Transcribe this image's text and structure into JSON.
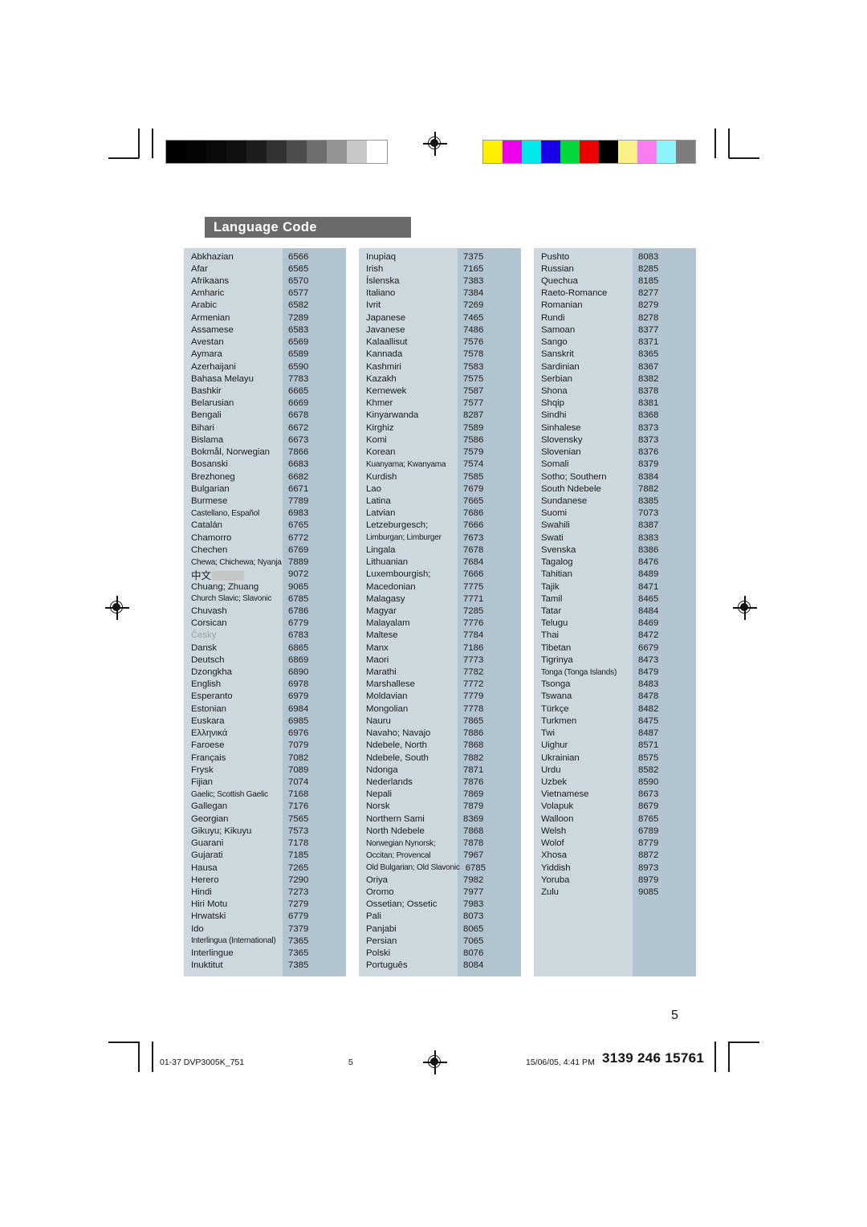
{
  "page": {
    "section_title": "Language Code",
    "page_number": "5"
  },
  "footer": {
    "job_id": "01-37 DVP3005K_751",
    "page_marker": "5",
    "timestamp": "15/06/05, 4:41 PM",
    "doc_code": "3139 246 15761"
  },
  "calibration": {
    "grayscale": [
      "#000000",
      "#040404",
      "#0a0a0a",
      "#111111",
      "#1d1d1d",
      "#333333",
      "#4d4d4d",
      "#6e6e6e",
      "#949494",
      "#c8c8c8",
      "#ffffff"
    ],
    "colors": [
      "#fff000",
      "#ec00ec",
      "#00e8ec",
      "#1800e8",
      "#00d83c",
      "#ec0000",
      "#000000",
      "#fbf287",
      "#fb7cf0",
      "#8cf4fb",
      "#7d7d7d"
    ]
  },
  "columns": [
    {
      "rows": [
        {
          "name": "Abkhazian",
          "code": "6566"
        },
        {
          "name": "Afar",
          "code": "6565"
        },
        {
          "name": "Afrikaans",
          "code": "6570"
        },
        {
          "name": "Amharic",
          "code": "6577"
        },
        {
          "name": "Arabic",
          "code": "6582"
        },
        {
          "name": "Armenian",
          "code": "7289"
        },
        {
          "name": "Assamese",
          "code": "6583"
        },
        {
          "name": "Avestan",
          "code": "6569"
        },
        {
          "name": "Aymara",
          "code": "6589"
        },
        {
          "name": "Azerhaijani",
          "code": "6590"
        },
        {
          "name": "Bahasa Melayu",
          "code": "7783"
        },
        {
          "name": "Bashkir",
          "code": "6665"
        },
        {
          "name": "Belarusian",
          "code": "6669"
        },
        {
          "name": "Bengali",
          "code": "6678"
        },
        {
          "name": "Bihari",
          "code": "6672"
        },
        {
          "name": "Bislama",
          "code": "6673"
        },
        {
          "name": "Bokmål, Norwegian",
          "code": "7866"
        },
        {
          "name": "Bosanski",
          "code": "6683"
        },
        {
          "name": "Brezhoneg",
          "code": "6682"
        },
        {
          "name": "Bulgarian",
          "code": "6671"
        },
        {
          "name": "Burmese",
          "code": "7789"
        },
        {
          "name": "Castellano, Español",
          "code": "6983",
          "narrow": true
        },
        {
          "name": "Catalán",
          "code": "6765"
        },
        {
          "name": "Chamorro",
          "code": "6772"
        },
        {
          "name": "Chechen",
          "code": "6769"
        },
        {
          "name": "Chewa; Chichewa; Nyanja",
          "code": "7889",
          "narrow": true
        },
        {
          "name": "中文",
          "code": "9072",
          "cjk": true,
          "highlight": true
        },
        {
          "name": "Chuang; Zhuang",
          "code": "9065"
        },
        {
          "name": "Church Slavic; Slavonic",
          "code": "6785",
          "narrow": true
        },
        {
          "name": "Chuvash",
          "code": "6786"
        },
        {
          "name": "Corsican",
          "code": "6779"
        },
        {
          "name": "Česky",
          "code": "6783",
          "faded": true
        },
        {
          "name": "Dansk",
          "code": "6865"
        },
        {
          "name": "Deutsch",
          "code": "6869"
        },
        {
          "name": "Dzongkha",
          "code": "6890"
        },
        {
          "name": "English",
          "code": "6978"
        },
        {
          "name": "Esperanto",
          "code": "6979"
        },
        {
          "name": "Estonian",
          "code": "6984"
        },
        {
          "name": "Euskara",
          "code": "6985"
        },
        {
          "name": "Ελληνικά",
          "code": "6976"
        },
        {
          "name": "Faroese",
          "code": "7079"
        },
        {
          "name": "Français",
          "code": "7082"
        },
        {
          "name": "Frysk",
          "code": "7089"
        },
        {
          "name": "Fijian",
          "code": "7074"
        },
        {
          "name": "Gaelic; Scottish Gaelic",
          "code": "7168",
          "narrow": true
        },
        {
          "name": "Gallegan",
          "code": "7176"
        },
        {
          "name": "Georgian",
          "code": "7565"
        },
        {
          "name": "Gikuyu; Kikuyu",
          "code": "7573"
        },
        {
          "name": "Guarani",
          "code": "7178"
        },
        {
          "name": "Gujarati",
          "code": "7185"
        },
        {
          "name": "Hausa",
          "code": "7265"
        },
        {
          "name": "Herero",
          "code": "7290"
        },
        {
          "name": "Hindi",
          "code": "7273"
        },
        {
          "name": "Hiri Motu",
          "code": "7279"
        },
        {
          "name": "Hrwatski",
          "code": "6779"
        },
        {
          "name": "Ido",
          "code": "7379"
        },
        {
          "name": "Interlingua (International)",
          "code": "7365",
          "narrow": true
        },
        {
          "name": "Interlingue",
          "code": "7365"
        },
        {
          "name": "Inuktitut",
          "code": "7385"
        }
      ]
    },
    {
      "rows": [
        {
          "name": "Inupiaq",
          "code": "7375"
        },
        {
          "name": "Irish",
          "code": "7165"
        },
        {
          "name": "Íslenska",
          "code": "7383"
        },
        {
          "name": "Italiano",
          "code": "7384"
        },
        {
          "name": "Ivrit",
          "code": "7269"
        },
        {
          "name": "Japanese",
          "code": "7465"
        },
        {
          "name": "Javanese",
          "code": "7486"
        },
        {
          "name": "Kalaallisut",
          "code": "7576"
        },
        {
          "name": "Kannada",
          "code": "7578"
        },
        {
          "name": "Kashmiri",
          "code": "7583"
        },
        {
          "name": "Kazakh",
          "code": "7575"
        },
        {
          "name": "Kernewek",
          "code": "7587"
        },
        {
          "name": "Khmer",
          "code": "7577"
        },
        {
          "name": "Kinyarwanda",
          "code": "8287"
        },
        {
          "name": "Kirghiz",
          "code": "7589"
        },
        {
          "name": "Komi",
          "code": "7586"
        },
        {
          "name": "Korean",
          "code": "7579"
        },
        {
          "name": "Kuanyama; Kwanyama",
          "code": "7574",
          "narrow": true
        },
        {
          "name": "Kurdish",
          "code": "7585"
        },
        {
          "name": "Lao",
          "code": "7679"
        },
        {
          "name": "Latina",
          "code": "7665"
        },
        {
          "name": "Latvian",
          "code": "7686"
        },
        {
          "name": "Letzeburgesch;",
          "code": "7666"
        },
        {
          "name": "Limburgan; Limburger",
          "code": "7673",
          "narrow": true
        },
        {
          "name": "Lingala",
          "code": "7678"
        },
        {
          "name": "Lithuanian",
          "code": "7684"
        },
        {
          "name": "Luxembourgish;",
          "code": "7666"
        },
        {
          "name": "Macedonian",
          "code": "7775"
        },
        {
          "name": "Malagasy",
          "code": "7771"
        },
        {
          "name": "Magyar",
          "code": "7285"
        },
        {
          "name": "Malayalam",
          "code": "7776"
        },
        {
          "name": "Maltese",
          "code": "7784"
        },
        {
          "name": "Manx",
          "code": "7186"
        },
        {
          "name": "Maori",
          "code": "7773"
        },
        {
          "name": "Marathi",
          "code": "7782"
        },
        {
          "name": "Marshallese",
          "code": "7772"
        },
        {
          "name": "Moldavian",
          "code": "7779"
        },
        {
          "name": "Mongolian",
          "code": "7778"
        },
        {
          "name": "Nauru",
          "code": "7865"
        },
        {
          "name": "Navaho; Navajo",
          "code": "7886"
        },
        {
          "name": "Ndebele, North",
          "code": "7868"
        },
        {
          "name": "Ndebele, South",
          "code": "7882"
        },
        {
          "name": "Ndonga",
          "code": "7871"
        },
        {
          "name": "Nederlands",
          "code": "7876"
        },
        {
          "name": "Nepali",
          "code": "7869"
        },
        {
          "name": "Norsk",
          "code": "7879"
        },
        {
          "name": "Northern Sami",
          "code": "8369"
        },
        {
          "name": "North Ndebele",
          "code": "7868"
        },
        {
          "name": "Norwegian Nynorsk;",
          "code": "7878",
          "narrow": true
        },
        {
          "name": "Occitan; Provencal",
          "code": "7967",
          "narrow": true
        },
        {
          "name": "Old Bulgarian; Old Slavonic",
          "code": "6785",
          "narrow": true
        },
        {
          "name": "Oriya",
          "code": "7982"
        },
        {
          "name": "Oromo",
          "code": "7977"
        },
        {
          "name": "Ossetian; Ossetic",
          "code": "7983"
        },
        {
          "name": "Pali",
          "code": "8073"
        },
        {
          "name": "Panjabi",
          "code": "8065"
        },
        {
          "name": "Persian",
          "code": "7065"
        },
        {
          "name": "Polski",
          "code": "8076"
        },
        {
          "name": "Português",
          "code": "8084"
        }
      ]
    },
    {
      "rows": [
        {
          "name": "Pushto",
          "code": "8083"
        },
        {
          "name": "Russian",
          "code": "8285"
        },
        {
          "name": "Quechua",
          "code": "8185"
        },
        {
          "name": "Raeto-Romance",
          "code": "8277"
        },
        {
          "name": "Romanian",
          "code": "8279"
        },
        {
          "name": "Rundi",
          "code": "8278"
        },
        {
          "name": "Samoan",
          "code": "8377"
        },
        {
          "name": "Sango",
          "code": "8371"
        },
        {
          "name": "Sanskrit",
          "code": "8365"
        },
        {
          "name": "Sardinian",
          "code": "8367"
        },
        {
          "name": "Serbian",
          "code": "8382"
        },
        {
          "name": "Shona",
          "code": "8378"
        },
        {
          "name": "Shqip",
          "code": "8381"
        },
        {
          "name": "Sindhi",
          "code": "8368"
        },
        {
          "name": "Sinhalese",
          "code": "8373"
        },
        {
          "name": "Slovensky",
          "code": "8373"
        },
        {
          "name": "Slovenian",
          "code": "8376"
        },
        {
          "name": "Somali",
          "code": "8379"
        },
        {
          "name": "Sotho; Southern",
          "code": "8384"
        },
        {
          "name": "South Ndebele",
          "code": "7882"
        },
        {
          "name": "Sundanese",
          "code": "8385"
        },
        {
          "name": "Suomi",
          "code": "7073"
        },
        {
          "name": "Swahili",
          "code": "8387"
        },
        {
          "name": "Swati",
          "code": "8383"
        },
        {
          "name": "Svenska",
          "code": "8386"
        },
        {
          "name": "Tagalog",
          "code": "8476"
        },
        {
          "name": "Tahitian",
          "code": "8489"
        },
        {
          "name": "Tajik",
          "code": "8471"
        },
        {
          "name": "Tamil",
          "code": "8465"
        },
        {
          "name": "Tatar",
          "code": "8484"
        },
        {
          "name": "Telugu",
          "code": "8469"
        },
        {
          "name": "Thai",
          "code": "8472"
        },
        {
          "name": "Tibetan",
          "code": "6679"
        },
        {
          "name": "Tigrinya",
          "code": "8473"
        },
        {
          "name": "Tonga (Tonga Islands)",
          "code": "8479",
          "narrow": true
        },
        {
          "name": "Tsonga",
          "code": "8483"
        },
        {
          "name": "Tswana",
          "code": "8478"
        },
        {
          "name": "Türkçe",
          "code": "8482"
        },
        {
          "name": "Turkmen",
          "code": "8475"
        },
        {
          "name": "Twi",
          "code": "8487"
        },
        {
          "name": "Uighur",
          "code": "8571"
        },
        {
          "name": "Ukrainian",
          "code": "8575"
        },
        {
          "name": "Urdu",
          "code": "8582"
        },
        {
          "name": "Uzbek",
          "code": "8590"
        },
        {
          "name": "Vietnamese",
          "code": "8673"
        },
        {
          "name": "Volapuk",
          "code": "8679"
        },
        {
          "name": "Walloon",
          "code": "8765"
        },
        {
          "name": "Welsh",
          "code": "6789"
        },
        {
          "name": "Wolof",
          "code": "8779"
        },
        {
          "name": "Xhosa",
          "code": "8872"
        },
        {
          "name": "Yiddish",
          "code": "8973"
        },
        {
          "name": "Yoruba",
          "code": "8979"
        },
        {
          "name": "Zulu",
          "code": "9085"
        },
        {
          "name": "",
          "code": ""
        },
        {
          "name": "",
          "code": ""
        },
        {
          "name": "",
          "code": ""
        },
        {
          "name": "",
          "code": ""
        },
        {
          "name": "",
          "code": ""
        },
        {
          "name": "",
          "code": ""
        }
      ]
    }
  ]
}
